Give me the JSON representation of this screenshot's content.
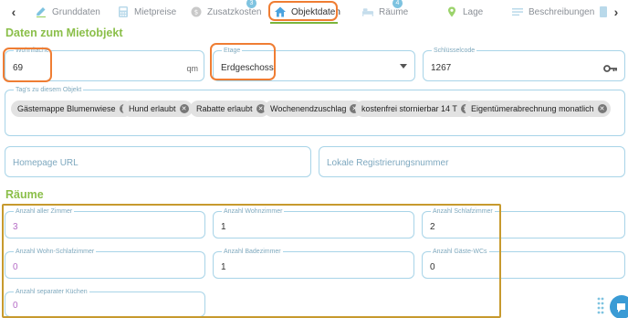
{
  "tabs": [
    {
      "label": "Grunddaten",
      "icon": "pencil-icon"
    },
    {
      "label": "Mietpreise",
      "icon": "calculator-icon"
    },
    {
      "label": "Zusatzkosten",
      "icon": "coin-icon",
      "badge": "3"
    },
    {
      "label": "Objektdaten",
      "icon": "home-icon",
      "active": true
    },
    {
      "label": "Räume",
      "icon": "bed-icon",
      "badge": "4"
    },
    {
      "label": "Lage",
      "icon": "map-pin-icon"
    },
    {
      "label": "Beschreibungen",
      "icon": "text-lines-icon"
    }
  ],
  "sections": {
    "mietobjekt_title": "Daten zum Mietobjekt",
    "raeume_title": "Räume"
  },
  "fields": {
    "wohnflaeche": {
      "label": "Wohnfläche",
      "value": "69",
      "unit": "qm"
    },
    "etage": {
      "label": "Etage",
      "value": "Erdgeschoss"
    },
    "schluesselcode": {
      "label": "Schlüsselcode",
      "value": "1267"
    },
    "tags": {
      "label": "Tag's zu diesem Objekt",
      "items": [
        "Gästemappe Blumenwiese",
        "Hund erlaubt",
        "Rabatte erlaubt",
        "Wochenendzuschlag",
        "kostenfrei stornierbar 14 T",
        "Eigentümerabrechnung monatlich"
      ]
    },
    "homepage_url": {
      "placeholder": "Homepage URL"
    },
    "lokale_registrierungsnummer": {
      "placeholder": "Lokale Registrierungsnummer"
    }
  },
  "rooms": {
    "anzahl_aller_zimmer": {
      "label": "Anzahl aller Zimmer",
      "value": "3"
    },
    "anzahl_wohnzimmer": {
      "label": "Anzahl Wohnzimmer",
      "value": "1"
    },
    "anzahl_schlafzimmer": {
      "label": "Anzahl Schlafzimmer",
      "value": "2"
    },
    "anzahl_wohn_schlafzimmer": {
      "label": "Anzahl Wohn-Schlafzimmer",
      "value": "0"
    },
    "anzahl_badezimmer": {
      "label": "Anzahl Badezimmer",
      "value": "1"
    },
    "anzahl_gaeste_wcs": {
      "label": "Anzahl Gäste-WCs",
      "value": "0"
    },
    "anzahl_separater_kuechen": {
      "label": "Anzahl separater Küchen",
      "value": "0"
    }
  },
  "colors": {
    "accent_green": "#8bbf4a",
    "field_border": "#a8d4e8",
    "highlight_orange": "#ef7d33",
    "highlight_gold": "#c79a2e",
    "chat_bubble": "#3a9bd5"
  }
}
